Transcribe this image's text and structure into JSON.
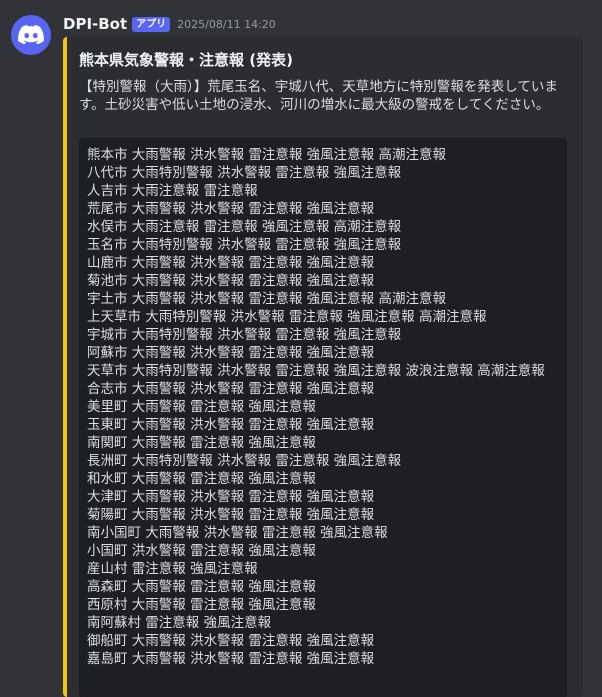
{
  "author": {
    "name": "DPI-Bot",
    "tag": "アプリ",
    "timestamp": "2025/08/11 14:20",
    "avatar_icon": "discord-logo-icon"
  },
  "embed": {
    "accent_color": "#f1c40f",
    "title": "熊本県気象警報・注意報 (発表)",
    "description": "【特別警報（大雨）】荒尾玉名、宇城八代、天草地方に特別警報を発表しています。土砂災害や低い土地の浸水、河川の増水に最大級の警戒をしてください。",
    "lines": [
      "熊本市 大雨警報 洪水警報 雷注意報 強風注意報 高潮注意報",
      "八代市 大雨特別警報 洪水警報 雷注意報 強風注意報",
      "人吉市 大雨注意報 雷注意報",
      "荒尾市 大雨警報 洪水警報 雷注意報 強風注意報",
      "水俣市 大雨注意報 雷注意報 強風注意報 高潮注意報",
      "玉名市 大雨特別警報 洪水警報 雷注意報 強風注意報",
      "山鹿市 大雨警報 洪水警報 雷注意報 強風注意報",
      "菊池市 大雨警報 洪水警報 雷注意報 強風注意報",
      "宇土市 大雨警報 洪水警報 雷注意報 強風注意報 高潮注意報",
      "上天草市 大雨特別警報 洪水警報 雷注意報 強風注意報 高潮注意報",
      "宇城市 大雨特別警報 洪水警報 雷注意報 強風注意報",
      "阿蘇市 大雨警報 洪水警報 雷注意報 強風注意報",
      "天草市 大雨特別警報 洪水警報 雷注意報 強風注意報 波浪注意報 高潮注意報",
      "合志市 大雨警報 洪水警報 雷注意報 強風注意報",
      "美里町 大雨警報 雷注意報 強風注意報",
      "玉東町 大雨警報 洪水警報 雷注意報 強風注意報",
      "南関町 大雨警報 雷注意報 強風注意報",
      "長洲町 大雨特別警報 洪水警報 雷注意報 強風注意報",
      "和水町 大雨警報 雷注意報 強風注意報",
      "大津町 大雨警報 洪水警報 雷注意報 強風注意報",
      "菊陽町 大雨警報 洪水警報 雷注意報 強風注意報",
      "南小国町 大雨警報 洪水警報 雷注意報 強風注意報",
      "小国町 洪水警報 雷注意報 強風注意報",
      "産山村 雷注意報 強風注意報",
      "高森町 大雨警報 雷注意報 強風注意報",
      "西原村 大雨警報 雷注意報 強風注意報",
      "南阿蘇村 雷注意報 強風注意報",
      "御船町 大雨警報 洪水警報 雷注意報 強風注意報",
      "嘉島町 大雨警報 洪水警報 雷注意報 強風注意報"
    ]
  }
}
